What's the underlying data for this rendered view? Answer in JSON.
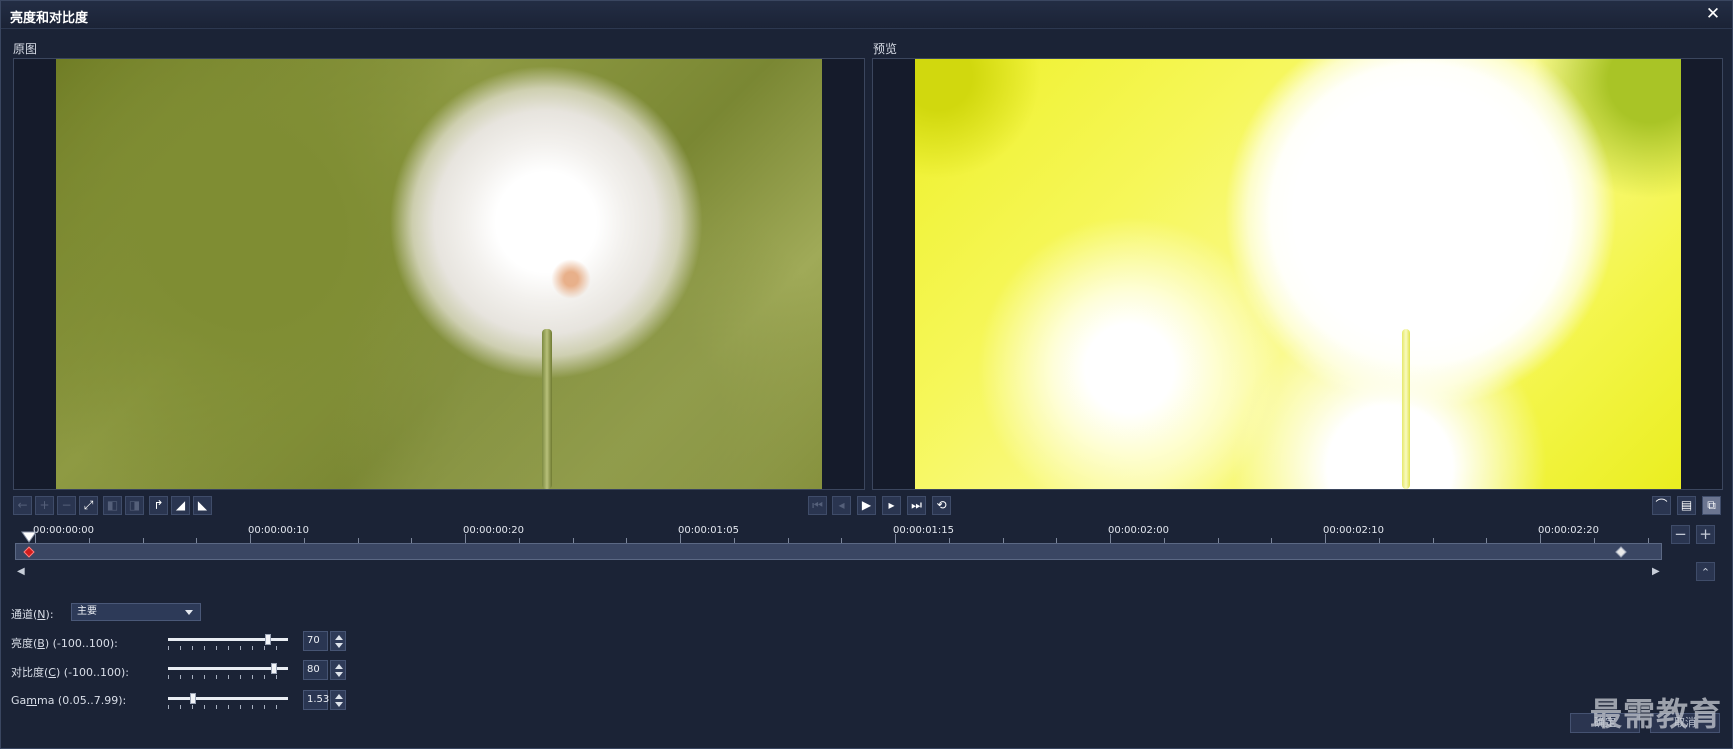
{
  "dialog": {
    "title": "亮度和对比度",
    "close_label": "✕"
  },
  "panels": {
    "original_label": "原图",
    "preview_label": "预览"
  },
  "toolbar": {
    "left_buttons": [
      "←",
      "+",
      "−",
      "⤢",
      "◧",
      "◨",
      "↱",
      "◢",
      "◣"
    ],
    "play_controls": [
      "⏮",
      "◂",
      "▶",
      "▸",
      "⏭",
      "⟲"
    ],
    "right_buttons": [
      "⌒",
      "▤",
      "⧉"
    ]
  },
  "timeline": {
    "labels": [
      "00:00:00:00",
      "00:00:00:10",
      "00:00:00:20",
      "00:00:01:05",
      "00:00:01:15",
      "00:00:02:00",
      "00:00:02:10",
      "00:00:02:20"
    ],
    "zoom_out": "−",
    "zoom_in": "+",
    "left_arrow": "◀",
    "right_arrow": "▶",
    "collapse": "⌃"
  },
  "controls": {
    "channel": {
      "label_prefix": "通道(",
      "label_key": "N",
      "label_suffix": "):",
      "value": "主要"
    },
    "brightness": {
      "label_prefix": "亮度(",
      "label_key": "B",
      "label_suffix": ") (-100..100):",
      "value": "70",
      "level": 0.85
    },
    "contrast": {
      "label_prefix": "对比度(",
      "label_key": "C",
      "label_suffix": ") (-100..100):",
      "value": "80",
      "level": 0.9
    },
    "gamma": {
      "label_prefix": "Ga",
      "label_key": "m",
      "label_suffix": "ma (0.05..7.99):",
      "value": "1.53",
      "level": 0.19
    }
  },
  "footer": {
    "ok": "确定",
    "cancel": "取消"
  },
  "watermark": "最需教育"
}
